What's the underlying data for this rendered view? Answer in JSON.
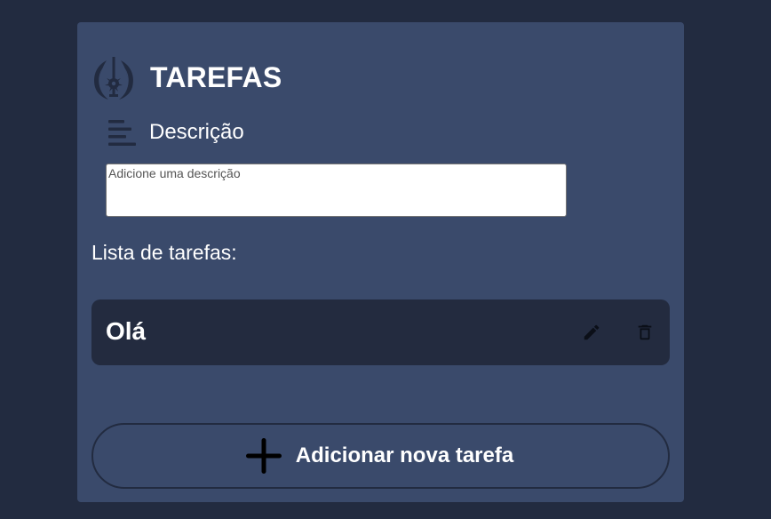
{
  "header": {
    "title": "TAREFAS",
    "logo_icon": "jedi-order-icon"
  },
  "description": {
    "label": "Descrição",
    "icon": "text-align-left-icon",
    "input_value": "",
    "input_placeholder": "Adicione uma descrição"
  },
  "task_list": {
    "label": "Lista de tarefas:",
    "items": [
      {
        "title": "Olá",
        "edit_icon": "pencil-icon",
        "delete_icon": "trash-icon"
      }
    ]
  },
  "add_button": {
    "label": "Adicionar nova tarefa",
    "icon": "plus-icon"
  },
  "colors": {
    "page_background": "#222b40",
    "panel_background": "#3a4a6b",
    "task_row_background": "#232b3f",
    "text": "#ffffff",
    "icon_dark": "#222b40"
  }
}
